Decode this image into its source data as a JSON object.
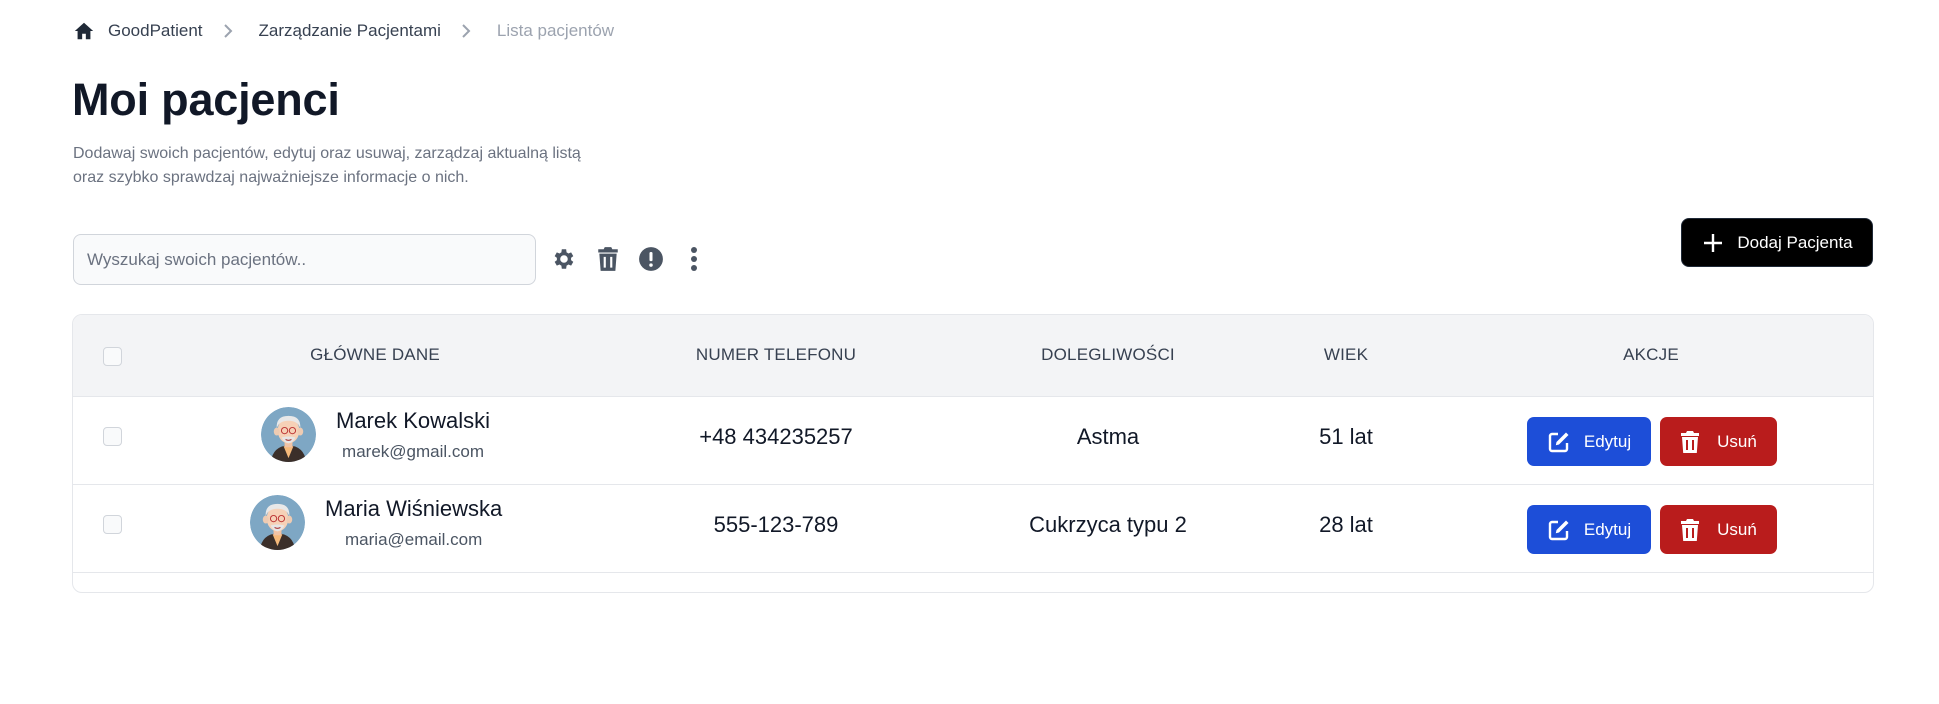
{
  "breadcrumb": {
    "home": "GoodPatient",
    "section": "Zarządzanie Pacjentami",
    "current": "Lista pacjentów"
  },
  "page": {
    "title": "Moi pacjenci",
    "description_line1": "Dodawaj swoich pacjentów, edytuj oraz usuwaj, zarządzaj aktualną listą",
    "description_line2": "oraz szybko sprawdzaj najważniejsze informacje o nich."
  },
  "toolbar": {
    "search_placeholder": "Wyszukaj swoich pacjentów..",
    "search_value": "",
    "icons": [
      "gear-icon",
      "trash-icon",
      "alert-circle-icon",
      "more-vertical-icon"
    ],
    "add_label": "Dodaj Pacjenta"
  },
  "table": {
    "columns": [
      "GŁÓWNE DANE",
      "NUMER TELEFONU",
      "DOLEGLIWOŚCI",
      "WIEK",
      "AKCJE"
    ],
    "rows": [
      {
        "name": "Marek Kowalski",
        "email": "marek@gmail.com",
        "phone": "+48 434235257",
        "ailment": "Astma",
        "age": "51 lat",
        "edit_label": "Edytuj",
        "delete_label": "Usuń"
      },
      {
        "name": "Maria Wiśniewska",
        "email": "maria@email.com",
        "phone": "555-123-789",
        "ailment": "Cukrzyca typu 2",
        "age": "28 lat",
        "edit_label": "Edytuj",
        "delete_label": "Usuń"
      }
    ]
  },
  "colors": {
    "primary_blue": "#1d4ed8",
    "danger_red": "#b91c1c",
    "add_button": "#000000",
    "header_bg": "#f3f4f6"
  }
}
